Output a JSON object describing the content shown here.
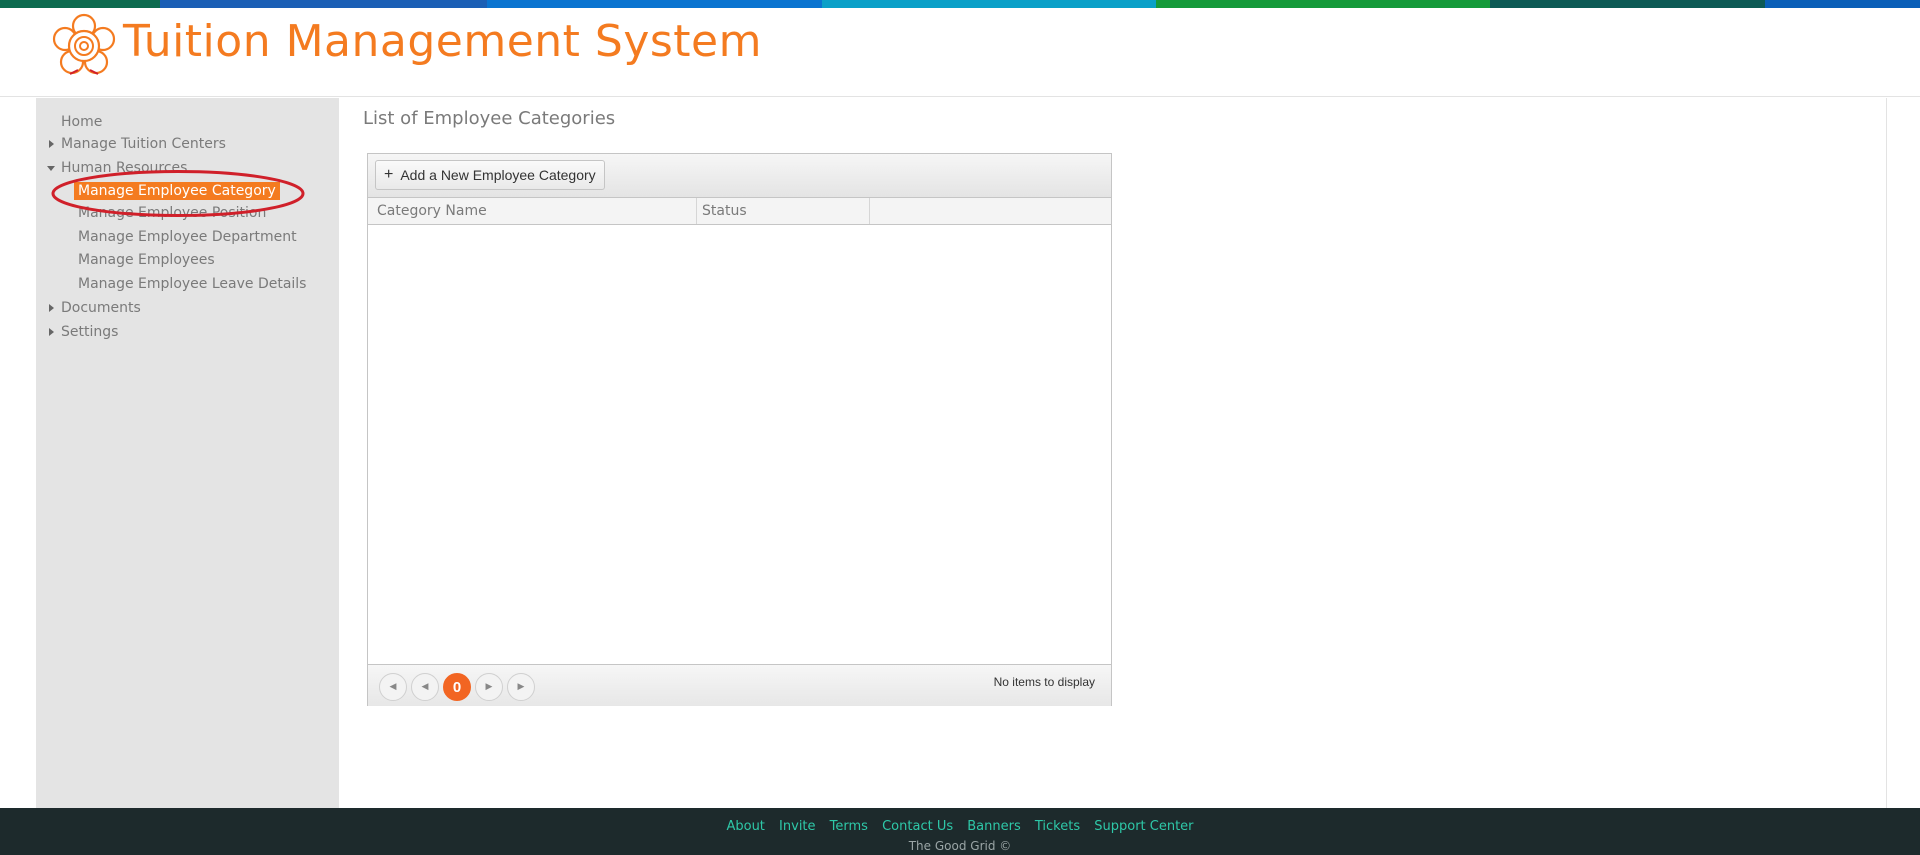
{
  "colors": {
    "accent": "#f47b20",
    "active_nav": "#f47b20",
    "pager_current": "#f26522",
    "footer_bg": "#1d2a2c",
    "footer_link": "#2ec8a8",
    "annotation": "#d0202a",
    "stripe": [
      "#0d6b4f",
      "#1b5fb5",
      "#0a74d0",
      "#0aa0c8",
      "#159a3a",
      "#0d5a55",
      "#0a5fb8"
    ]
  },
  "header": {
    "logo_icon": "flower-logo-icon",
    "title": "Tuition Management System"
  },
  "sidebar": {
    "items": [
      {
        "label": "Home"
      },
      {
        "label": "Manage Tuition Centers",
        "icon": "arrow-right-icon"
      },
      {
        "label": "Human Resources",
        "icon": "arrow-down-icon",
        "children": [
          {
            "label": "Manage Employee Category",
            "active": true
          },
          {
            "label": "Manage Employee Position"
          },
          {
            "label": "Manage Employee Department"
          },
          {
            "label": "Manage Employees"
          },
          {
            "label": "Manage Employee Leave Details"
          }
        ]
      },
      {
        "label": "Documents",
        "icon": "arrow-right-icon"
      },
      {
        "label": "Settings",
        "icon": "arrow-right-icon"
      }
    ]
  },
  "main": {
    "page_title": "List of Employee Categories",
    "grid": {
      "add_button_label": "Add a New Employee Category",
      "add_button_icon": "plus-icon",
      "columns": [
        "Category Name",
        "Status"
      ],
      "rows": [],
      "pager": {
        "current_page": "0",
        "info": "No items to display",
        "icons": [
          "first-page-icon",
          "prev-page-icon",
          "next-page-icon",
          "last-page-icon"
        ]
      }
    }
  },
  "footer": {
    "links": [
      "About",
      "Invite",
      "Terms",
      "Contact Us",
      "Banners",
      "Tickets",
      "Support Center"
    ],
    "copyright": "The Good Grid ©"
  }
}
